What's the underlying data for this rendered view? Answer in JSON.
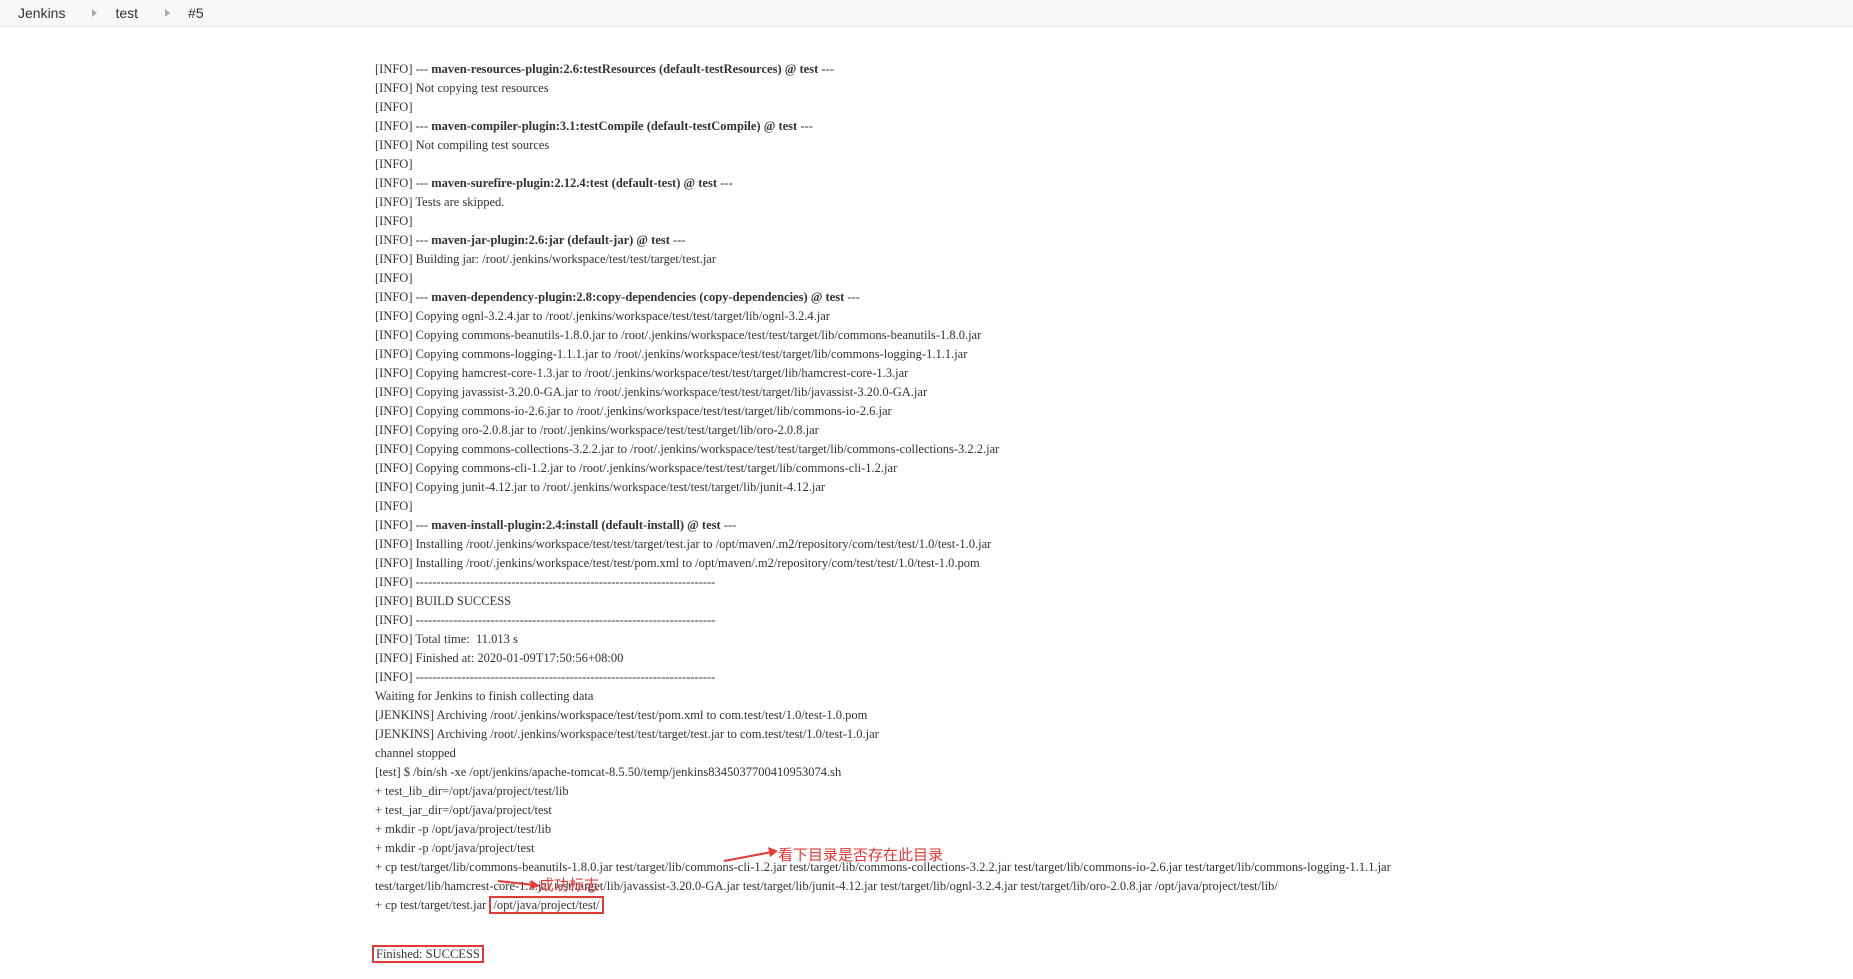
{
  "breadcrumb": {
    "items": [
      {
        "label": "Jenkins"
      },
      {
        "label": "test"
      },
      {
        "label": "#5"
      }
    ]
  },
  "console": {
    "lines": [
      {
        "pre": "[INFO] --- ",
        "bold": "maven-resources-plugin:2.6:testResources (default-testResources) @ test",
        "post": " ---"
      },
      {
        "pre": "[INFO] Not copying test resources"
      },
      {
        "pre": "[INFO]"
      },
      {
        "pre": "[INFO] --- ",
        "bold": "maven-compiler-plugin:3.1:testCompile (default-testCompile) @ test",
        "post": " ---"
      },
      {
        "pre": "[INFO] Not compiling test sources"
      },
      {
        "pre": "[INFO]"
      },
      {
        "pre": "[INFO] --- ",
        "bold": "maven-surefire-plugin:2.12.4:test (default-test) @ test",
        "post": " ---"
      },
      {
        "pre": "[INFO] Tests are skipped."
      },
      {
        "pre": "[INFO]"
      },
      {
        "pre": "[INFO] --- ",
        "bold": "maven-jar-plugin:2.6:jar (default-jar) @ test",
        "post": " ---"
      },
      {
        "pre": "[INFO] Building jar: /root/.jenkins/workspace/test/test/target/test.jar"
      },
      {
        "pre": "[INFO]"
      },
      {
        "pre": "[INFO] --- ",
        "bold": "maven-dependency-plugin:2.8:copy-dependencies (copy-dependencies) @ test",
        "post": " ---"
      },
      {
        "pre": "[INFO] Copying ognl-3.2.4.jar to /root/.jenkins/workspace/test/test/target/lib/ognl-3.2.4.jar"
      },
      {
        "pre": "[INFO] Copying commons-beanutils-1.8.0.jar to /root/.jenkins/workspace/test/test/target/lib/commons-beanutils-1.8.0.jar"
      },
      {
        "pre": "[INFO] Copying commons-logging-1.1.1.jar to /root/.jenkins/workspace/test/test/target/lib/commons-logging-1.1.1.jar"
      },
      {
        "pre": "[INFO] Copying hamcrest-core-1.3.jar to /root/.jenkins/workspace/test/test/target/lib/hamcrest-core-1.3.jar"
      },
      {
        "pre": "[INFO] Copying javassist-3.20.0-GA.jar to /root/.jenkins/workspace/test/test/target/lib/javassist-3.20.0-GA.jar"
      },
      {
        "pre": "[INFO] Copying commons-io-2.6.jar to /root/.jenkins/workspace/test/test/target/lib/commons-io-2.6.jar"
      },
      {
        "pre": "[INFO] Copying oro-2.0.8.jar to /root/.jenkins/workspace/test/test/target/lib/oro-2.0.8.jar"
      },
      {
        "pre": "[INFO] Copying commons-collections-3.2.2.jar to /root/.jenkins/workspace/test/test/target/lib/commons-collections-3.2.2.jar"
      },
      {
        "pre": "[INFO] Copying commons-cli-1.2.jar to /root/.jenkins/workspace/test/test/target/lib/commons-cli-1.2.jar"
      },
      {
        "pre": "[INFO] Copying junit-4.12.jar to /root/.jenkins/workspace/test/test/target/lib/junit-4.12.jar"
      },
      {
        "pre": "[INFO]"
      },
      {
        "pre": "[INFO] --- ",
        "bold": "maven-install-plugin:2.4:install (default-install) @ test",
        "post": " ---"
      },
      {
        "pre": "[INFO] Installing /root/.jenkins/workspace/test/test/target/test.jar to /opt/maven/.m2/repository/com/test/test/1.0/test-1.0.jar"
      },
      {
        "pre": "[INFO] Installing /root/.jenkins/workspace/test/test/pom.xml to /opt/maven/.m2/repository/com/test/test/1.0/test-1.0.pom"
      },
      {
        "pre": "[INFO] ------------------------------------------------------------------------"
      },
      {
        "pre": "[INFO] BUILD SUCCESS"
      },
      {
        "pre": "[INFO] ------------------------------------------------------------------------"
      },
      {
        "pre": "[INFO] Total time:  11.013 s"
      },
      {
        "pre": "[INFO] Finished at: 2020-01-09T17:50:56+08:00"
      },
      {
        "pre": "[INFO] ------------------------------------------------------------------------"
      },
      {
        "pre": "Waiting for Jenkins to finish collecting data"
      },
      {
        "pre": "[JENKINS] Archiving /root/.jenkins/workspace/test/test/pom.xml to com.test/test/1.0/test-1.0.pom"
      },
      {
        "pre": "[JENKINS] Archiving /root/.jenkins/workspace/test/test/target/test.jar to com.test/test/1.0/test-1.0.jar"
      },
      {
        "pre": "channel stopped"
      },
      {
        "pre": "[test] $ /bin/sh -xe /opt/jenkins/apache-tomcat-8.5.50/temp/jenkins8345037700410953074.sh"
      },
      {
        "pre": "+ test_lib_dir=/opt/java/project/test/lib"
      },
      {
        "pre": "+ test_jar_dir=/opt/java/project/test"
      },
      {
        "pre": "+ mkdir -p /opt/java/project/test/lib"
      },
      {
        "pre": "+ mkdir -p /opt/java/project/test"
      },
      {
        "pre": "+ cp test/target/lib/commons-beanutils-1.8.0.jar test/target/lib/commons-cli-1.2.jar test/target/lib/commons-collections-3.2.2.jar test/target/lib/commons-io-2.6.jar test/target/lib/commons-logging-1.1.1.jar"
      },
      {
        "pre": "test/target/lib/hamcrest-core-1.3.jar test/target/lib/javassist-3.20.0-GA.jar test/target/lib/junit-4.12.jar test/target/lib/ognl-3.2.4.jar test/target/lib/oro-2.0.8.jar /opt/java/project/test/lib/"
      }
    ],
    "cp_line": {
      "prefix": "+ cp test/target/test.jar ",
      "boxed": "/opt/java/project/test/"
    },
    "finished_line": "Finished: SUCCESS"
  },
  "annotations": {
    "directory_note": "看下目录是否存在此目录",
    "success_note": "成功标志",
    "color": "#e53935"
  }
}
